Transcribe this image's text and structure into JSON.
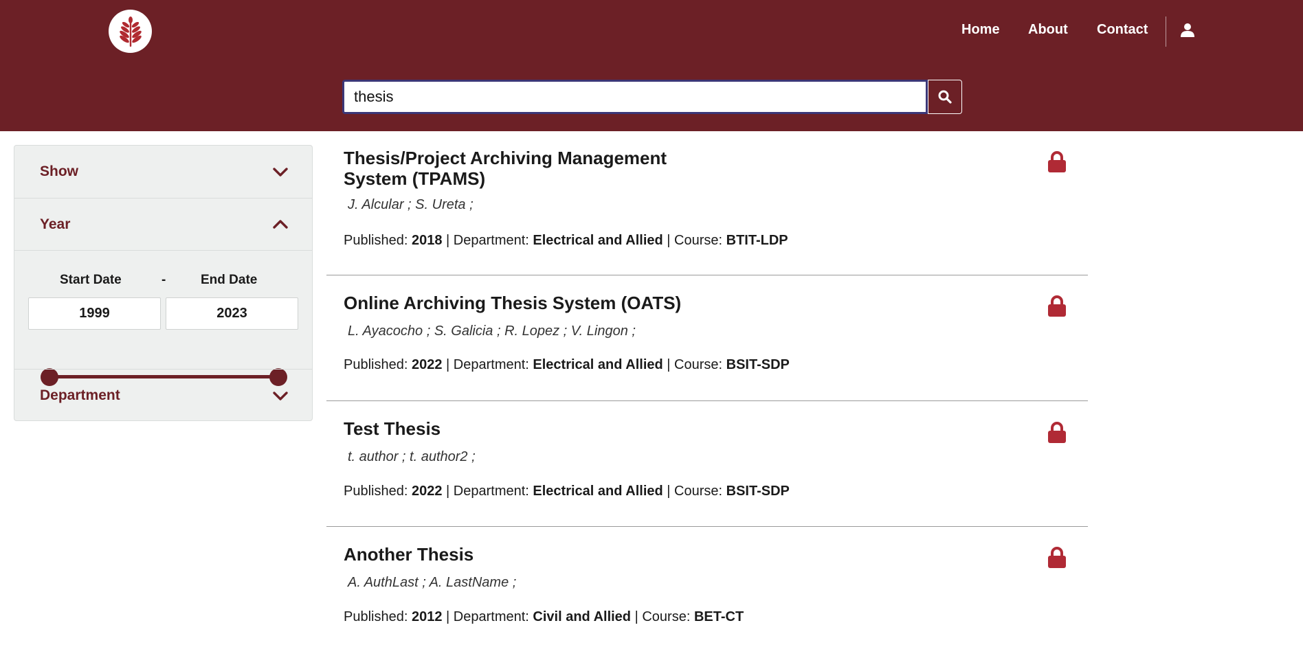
{
  "header": {
    "nav": {
      "home": "Home",
      "about": "About",
      "contact": "Contact"
    },
    "search": {
      "value": "thesis",
      "placeholder": ""
    },
    "colors": {
      "brand": "#6c2026",
      "search_border": "#3b3777"
    }
  },
  "sidebar": {
    "show_label": "Show",
    "year_label": "Year",
    "start_label": "Start Date",
    "dash": "-",
    "end_label": "End Date",
    "start_value": "1999",
    "end_value": "2023",
    "department_label": "Department"
  },
  "results": [
    {
      "title": "Thesis/Project Archiving Management System (TPAMS)",
      "authors": "J. Alcular ;  S. Ureta ;",
      "published_label": "Published:",
      "year": "2018",
      "department_label": "| Department:",
      "department": "Electrical and Allied",
      "course_label": "| Course:",
      "course": "BTIT-LDP"
    },
    {
      "title": "Online Archiving Thesis System (OATS)",
      "authors": "L. Ayacocho ;  S. Galicia ;  R. Lopez ;  V. Lingon ;",
      "published_label": "Published:",
      "year": "2022",
      "department_label": "| Department:",
      "department": "Electrical and Allied",
      "course_label": "| Course:",
      "course": "BSIT-SDP"
    },
    {
      "title": "Test Thesis",
      "authors": "t. author ;  t. author2 ;",
      "published_label": "Published:",
      "year": "2022",
      "department_label": "| Department:",
      "department": "Electrical and Allied",
      "course_label": "| Course:",
      "course": "BSIT-SDP"
    },
    {
      "title": "Another Thesis",
      "authors": "A. AuthLast ;  A. LastName ;",
      "published_label": "Published:",
      "year": "2012",
      "department_label": "| Department:",
      "department": "Civil and Allied",
      "course_label": "| Course:",
      "course": "BET-CT"
    }
  ]
}
